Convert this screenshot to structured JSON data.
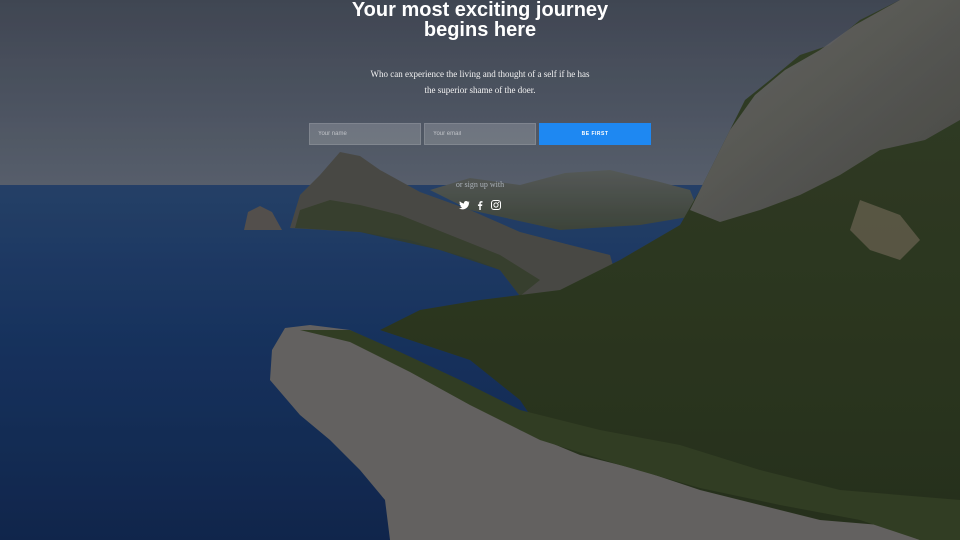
{
  "hero": {
    "title_line1": "Your most exciting journey",
    "title_line2": "begins here",
    "subtitle_line1": "Who can experience the living and thought of a self if he has",
    "subtitle_line2": "the superior shame of the doer."
  },
  "form": {
    "name_placeholder": "Your name",
    "email_placeholder": "Your email",
    "submit_label": "BE FIRST"
  },
  "social": {
    "alt_text": "or sign up with",
    "icons": [
      "twitter-icon",
      "facebook-icon",
      "instagram-icon"
    ]
  },
  "colors": {
    "accent": "#1e88f2",
    "sky": "#5b6472",
    "sea": "#163a6e",
    "forest": "#3d4a1e"
  }
}
